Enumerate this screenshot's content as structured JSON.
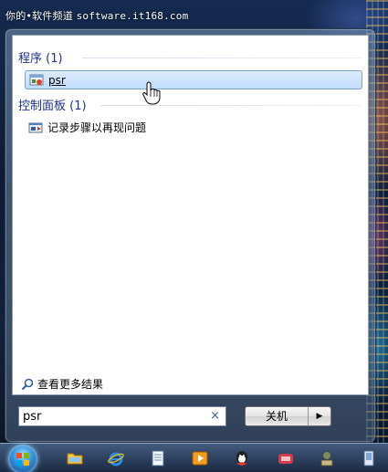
{
  "watermark": {
    "prefix": "你的•软件频道",
    "site": "software.it168.com"
  },
  "start_menu": {
    "groups": [
      {
        "header": "程序 (1)",
        "items": [
          {
            "label": "psr",
            "icon": "program-icon",
            "selected": true
          }
        ]
      },
      {
        "header": "控制面板 (1)",
        "items": [
          {
            "label": "记录步骤以再现问题",
            "icon": "control-panel-icon",
            "selected": false
          }
        ]
      }
    ],
    "see_more": "查看更多结果",
    "search": {
      "value": "psr",
      "clear_icon": "×"
    },
    "shutdown": {
      "label": "关机",
      "arrow": "▶"
    }
  },
  "taskbar": {
    "icons": [
      "folder-icon",
      "ie-icon",
      "notepad-icon",
      "media-player-icon",
      "qq-icon",
      "app-icon",
      "network-icon",
      "device-icon"
    ]
  },
  "colors": {
    "group_header": "#1e3287",
    "selection": "#c1dcfc"
  }
}
